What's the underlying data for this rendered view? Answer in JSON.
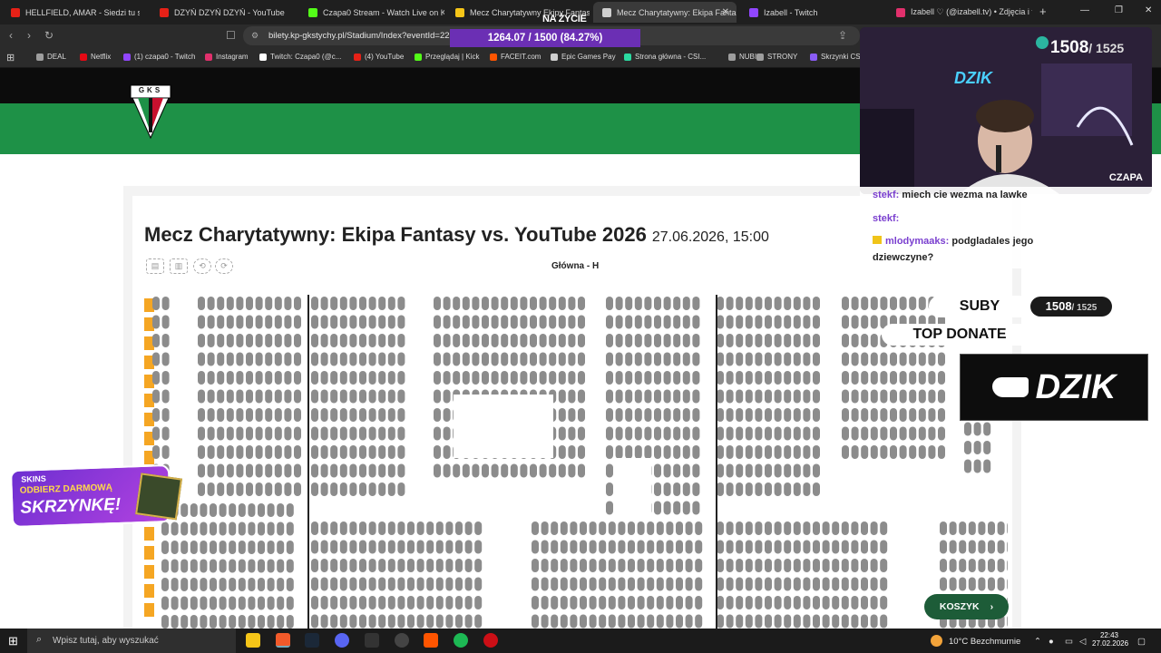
{
  "browser": {
    "tabs": [
      {
        "label": "HELLFIELD, AMAR - Siedzi tu san",
        "color": "#e62117"
      },
      {
        "label": "DZYŃ DZYŃ DZYŃ - YouTube",
        "color": "#e62117"
      },
      {
        "label": "Czapa0 Stream - Watch Live on Kick",
        "color": "#53fc18"
      },
      {
        "label": "Mecz Charytatywny Ekipy Fantasy",
        "color": "#f5c518"
      },
      {
        "label": "Mecz Charytatywny: Ekipa Fanta",
        "color": "#cfcfcf",
        "active": true
      },
      {
        "label": "Izabell - Twitch",
        "color": "#9146ff"
      },
      {
        "label": "Izabell ♡ (@izabell.tv) • Zdjęcia i filmy",
        "color": "#e1306c"
      }
    ],
    "close_glyph": "✕",
    "new_tab_glyph": "+",
    "url": "bilety.kp-gkstychy.pl/Stadium/Index?eventId=228",
    "bookmarks": [
      {
        "label": "DEAL",
        "color": "#9e9e9e"
      },
      {
        "label": "Netflix",
        "color": "#e50914"
      },
      {
        "label": "(1) czapa0 - Twitch",
        "color": "#9146ff"
      },
      {
        "label": "Instagram",
        "color": "#e1306c"
      },
      {
        "label": "Twitch: Czapa0 (@c...",
        "color": "#ffffff"
      },
      {
        "label": "(4) YouTube",
        "color": "#e62117"
      },
      {
        "label": "Przeglądaj | Kick",
        "color": "#53fc18"
      },
      {
        "label": "FACEIT.com",
        "color": "#ff5500"
      },
      {
        "label": "Epic Games Pay",
        "color": "#cfcfcf"
      },
      {
        "label": "Strona główna - CSI...",
        "color": "#2bd9a0"
      },
      {
        "label": "NUBI",
        "color": "#9e9e9e"
      },
      {
        "label": "STRONY",
        "color": "#9e9e9e"
      },
      {
        "label": "Skrzynki CSs",
        "color": "#8a5cf6"
      }
    ]
  },
  "page": {
    "title": "Mecz Charytatywny: Ekipa Fantasy vs. YouTube 2026",
    "datetime": "27.06.2026, 15:00",
    "sector": "Główna - H",
    "cart_label": "KOSZYK",
    "cart_glyph": "›",
    "club_logo_text": "GKS",
    "colors": {
      "green": "#1e9147",
      "seat": "#8c8c8c",
      "row_marker": "#f5a623",
      "cart": "#1d5c38"
    }
  },
  "stream": {
    "goal_title": "NA ŻYCIE",
    "goal_progress": "1264.07 / 1500 (84.27%)",
    "subs_current": "1508",
    "subs_goal": "/ 1525",
    "cam_brand": "DZIK",
    "cam_label": "CZAPA",
    "suby_label": "SUBY",
    "top_donate_label": "TOP DONATE",
    "ad_brand": "DZIK",
    "skins_brand": "SKINS",
    "skins_line1": "ODBIERZ DARMOWĄ",
    "skins_line2": "SKRZYNKĘ!",
    "chat": [
      {
        "user": "stekf:",
        "msg": "miech cie wezma na lawke"
      },
      {
        "user": "stekf:",
        "msg": ""
      },
      {
        "user": "mlodymaaks:",
        "msg": "podgladales jego"
      },
      {
        "user": "",
        "msg": "dziewczyne?"
      }
    ]
  },
  "taskbar": {
    "search_placeholder": "Wpisz tutaj, aby wyszukać",
    "weather": "10°C  Bezchmurnie",
    "time": "22:43",
    "date": "27.02.2026"
  }
}
